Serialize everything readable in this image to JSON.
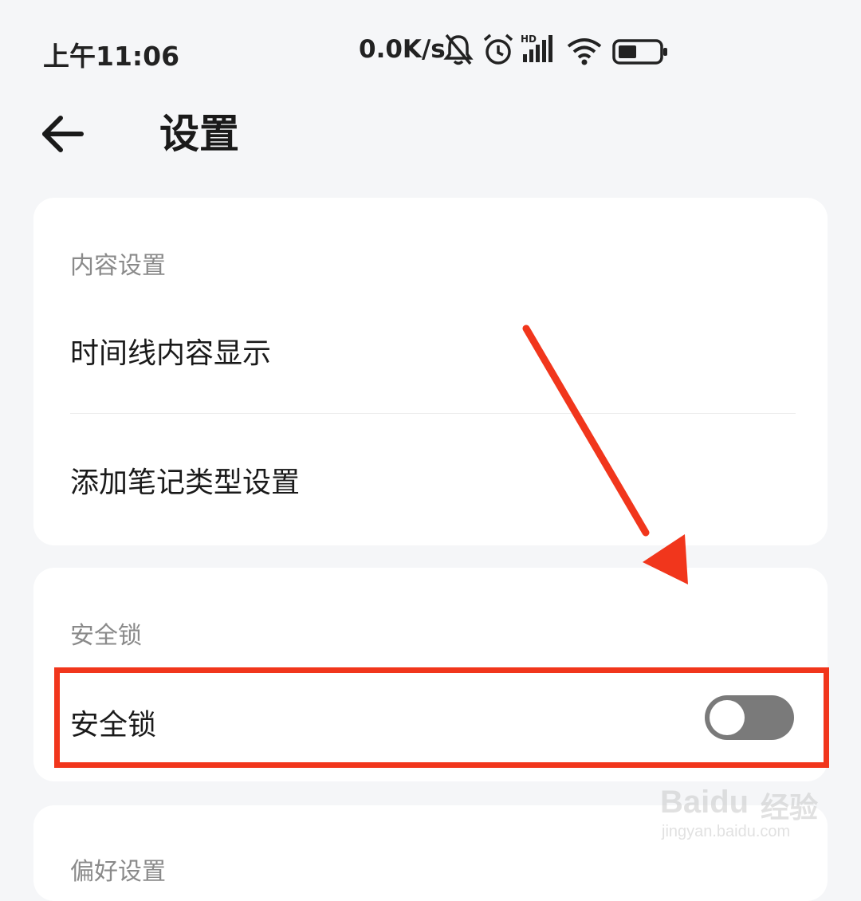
{
  "status_bar": {
    "time": "上午11:06",
    "net_speed": "0.0K/s",
    "icons": [
      "bell-muted-icon",
      "alarm-icon",
      "hd-signal-icon",
      "wifi-icon",
      "battery-icon"
    ]
  },
  "header": {
    "back_icon": "arrow-left-icon",
    "title": "设置"
  },
  "content_settings": {
    "section_title": "内容设置",
    "items": [
      "时间线内容显示",
      "添加笔记类型设置"
    ]
  },
  "security_lock": {
    "section_title": "安全锁",
    "item_label": "安全锁",
    "toggle_on": false
  },
  "next_section": {
    "section_title": "偏好设置"
  },
  "annotation": {
    "color": "#f1361c"
  },
  "watermark": {
    "brand": "Baidu",
    "brand_cn": "经验",
    "url": "jingyan.baidu.com"
  }
}
